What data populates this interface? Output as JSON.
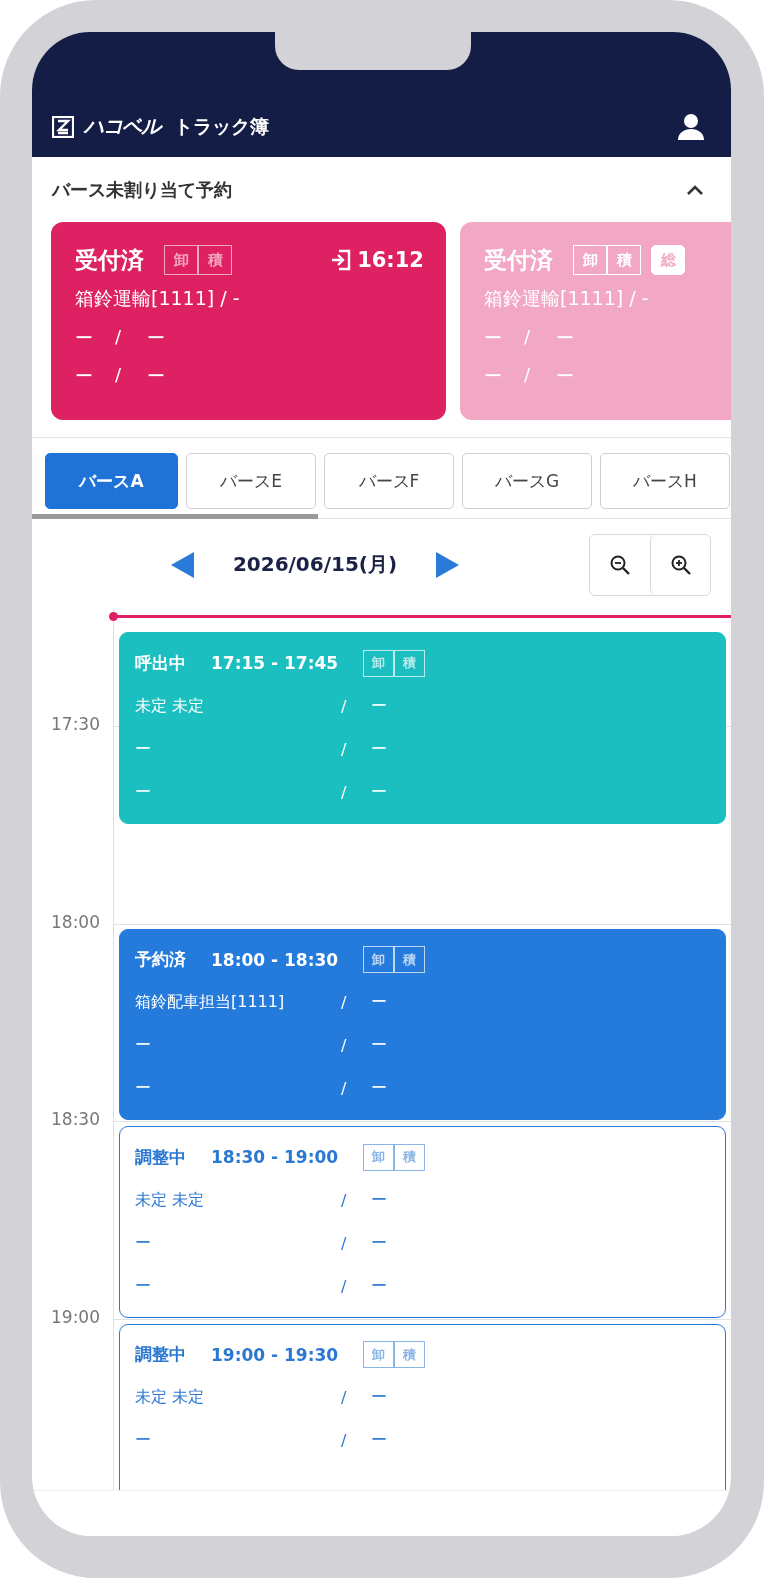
{
  "header": {
    "brand": "ハコベル",
    "product": "トラック簿"
  },
  "unassigned": {
    "title": "バース未割り当て予約",
    "expanded": true,
    "cards": [
      {
        "selected": true,
        "status": "受付済",
        "tags": [
          {
            "label": "卸",
            "active": false
          },
          {
            "label": "積",
            "active": false
          }
        ],
        "checkin_time": "16:12",
        "company": "箱鈴運輸[1111] / -",
        "rows": [
          {
            "left": "ー",
            "sep": "/",
            "right": "ー"
          },
          {
            "left": "ー",
            "sep": "/",
            "right": "ー"
          }
        ]
      },
      {
        "selected": false,
        "status": "受付済",
        "tags": [
          {
            "label": "卸",
            "active": false
          },
          {
            "label": "積",
            "active": false
          },
          {
            "label": "総",
            "active": true
          }
        ],
        "company": "箱鈴運輸[1111] / -",
        "rows": [
          {
            "left": "ー",
            "sep": "/",
            "right": "ー"
          },
          {
            "left": "ー",
            "sep": "/",
            "right": "ー"
          }
        ]
      }
    ]
  },
  "berth_tabs": [
    {
      "label": "バースA",
      "selected": true
    },
    {
      "label": "バースE",
      "selected": false
    },
    {
      "label": "バースF",
      "selected": false
    },
    {
      "label": "バースG",
      "selected": false
    },
    {
      "label": "バースH",
      "selected": false
    }
  ],
  "date": "2026/06/15(月)",
  "time_labels": [
    "17:30",
    "18:00",
    "18:30",
    "19:00"
  ],
  "events": [
    {
      "kind": "calling",
      "status": "呼出中",
      "time": "17:15 - 17:45",
      "tags": [
        {
          "label": "卸",
          "active": false
        },
        {
          "label": "積",
          "active": false
        }
      ],
      "rows": [
        {
          "left": "未定 未定",
          "sep": "/",
          "right": "ー"
        },
        {
          "left": "ー",
          "sep": "/",
          "right": "ー"
        },
        {
          "left": "ー",
          "sep": "/",
          "right": "ー"
        }
      ]
    },
    {
      "kind": "reserved",
      "status": "予約済",
      "time": "18:00 - 18:30",
      "tags": [
        {
          "label": "卸",
          "active": false
        },
        {
          "label": "積",
          "active": false
        }
      ],
      "rows": [
        {
          "left": "箱鈴配車担当[1111]",
          "sep": "/",
          "right": "ー"
        },
        {
          "left": "ー",
          "sep": "/",
          "right": "ー"
        },
        {
          "left": "ー",
          "sep": "/",
          "right": "ー"
        }
      ]
    },
    {
      "kind": "adjusting",
      "status": "調整中",
      "time": "18:30 - 19:00",
      "tags": [
        {
          "label": "卸",
          "active": false
        },
        {
          "label": "積",
          "active": false
        }
      ],
      "rows": [
        {
          "left": "未定 未定",
          "sep": "/",
          "right": "ー"
        },
        {
          "left": "ー",
          "sep": "/",
          "right": "ー"
        },
        {
          "left": "ー",
          "sep": "/",
          "right": "ー"
        }
      ]
    },
    {
      "kind": "adjusting",
      "status": "調整中",
      "time": "19:00 - 19:30",
      "tags": [
        {
          "label": "卸",
          "active": false
        },
        {
          "label": "積",
          "active": false
        }
      ],
      "rows": [
        {
          "left": "未定 未定",
          "sep": "/",
          "right": "ー"
        },
        {
          "left": "ー",
          "sep": "/",
          "right": "ー"
        }
      ]
    }
  ]
}
